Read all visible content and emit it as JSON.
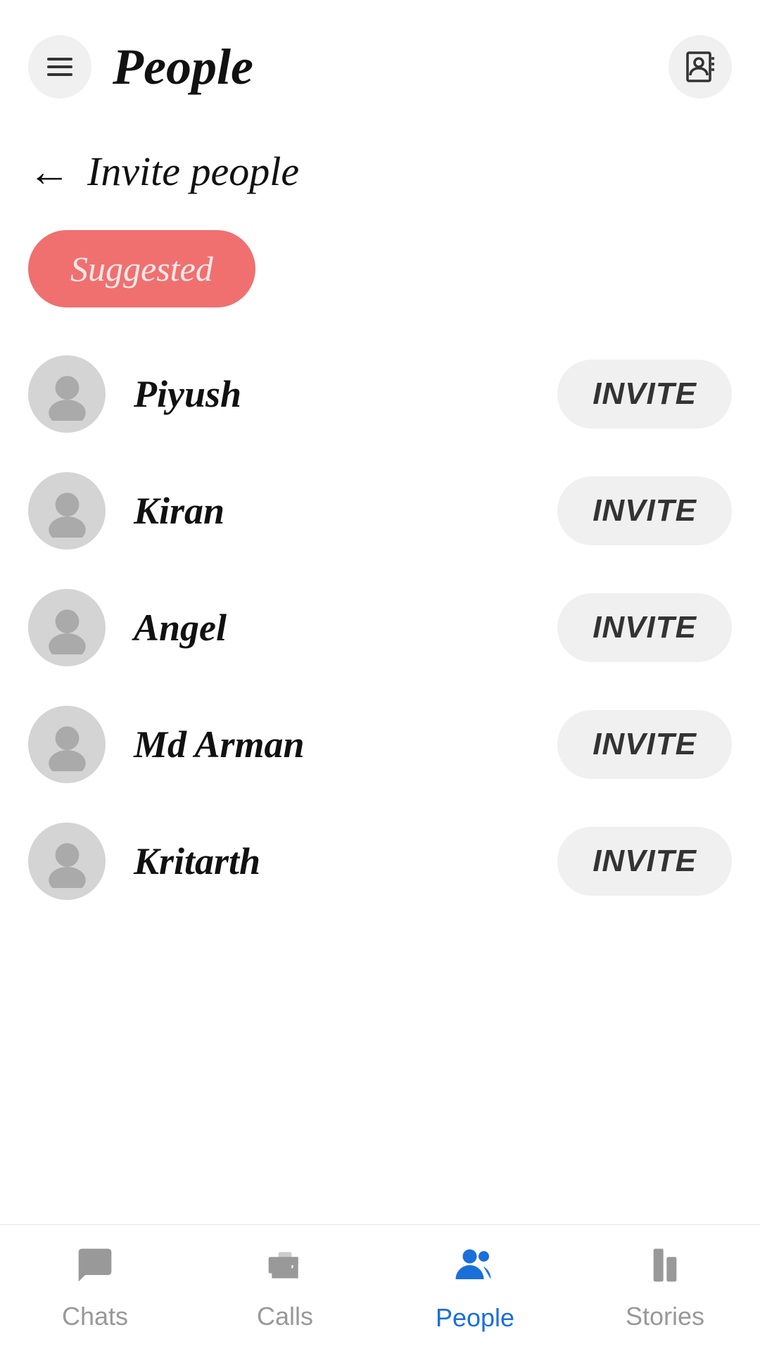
{
  "header": {
    "title": "People",
    "menu_label": "menu",
    "contacts_label": "contacts"
  },
  "invite_section": {
    "back_label": "←",
    "title": "Invite people",
    "suggested_label": "Suggested"
  },
  "people": [
    {
      "name": "Piyush",
      "invite_label": "INVITE"
    },
    {
      "name": "Kiran",
      "invite_label": "INVITE"
    },
    {
      "name": "Angel",
      "invite_label": "INVITE"
    },
    {
      "name": "Md Arman",
      "invite_label": "INVITE"
    },
    {
      "name": "Kritarth",
      "invite_label": "INVITE"
    }
  ],
  "bottom_nav": {
    "items": [
      {
        "label": "Chats",
        "active": false,
        "icon": "chat"
      },
      {
        "label": "Calls",
        "active": false,
        "icon": "calls"
      },
      {
        "label": "People",
        "active": true,
        "icon": "people"
      },
      {
        "label": "Stories",
        "active": false,
        "icon": "stories"
      }
    ]
  }
}
